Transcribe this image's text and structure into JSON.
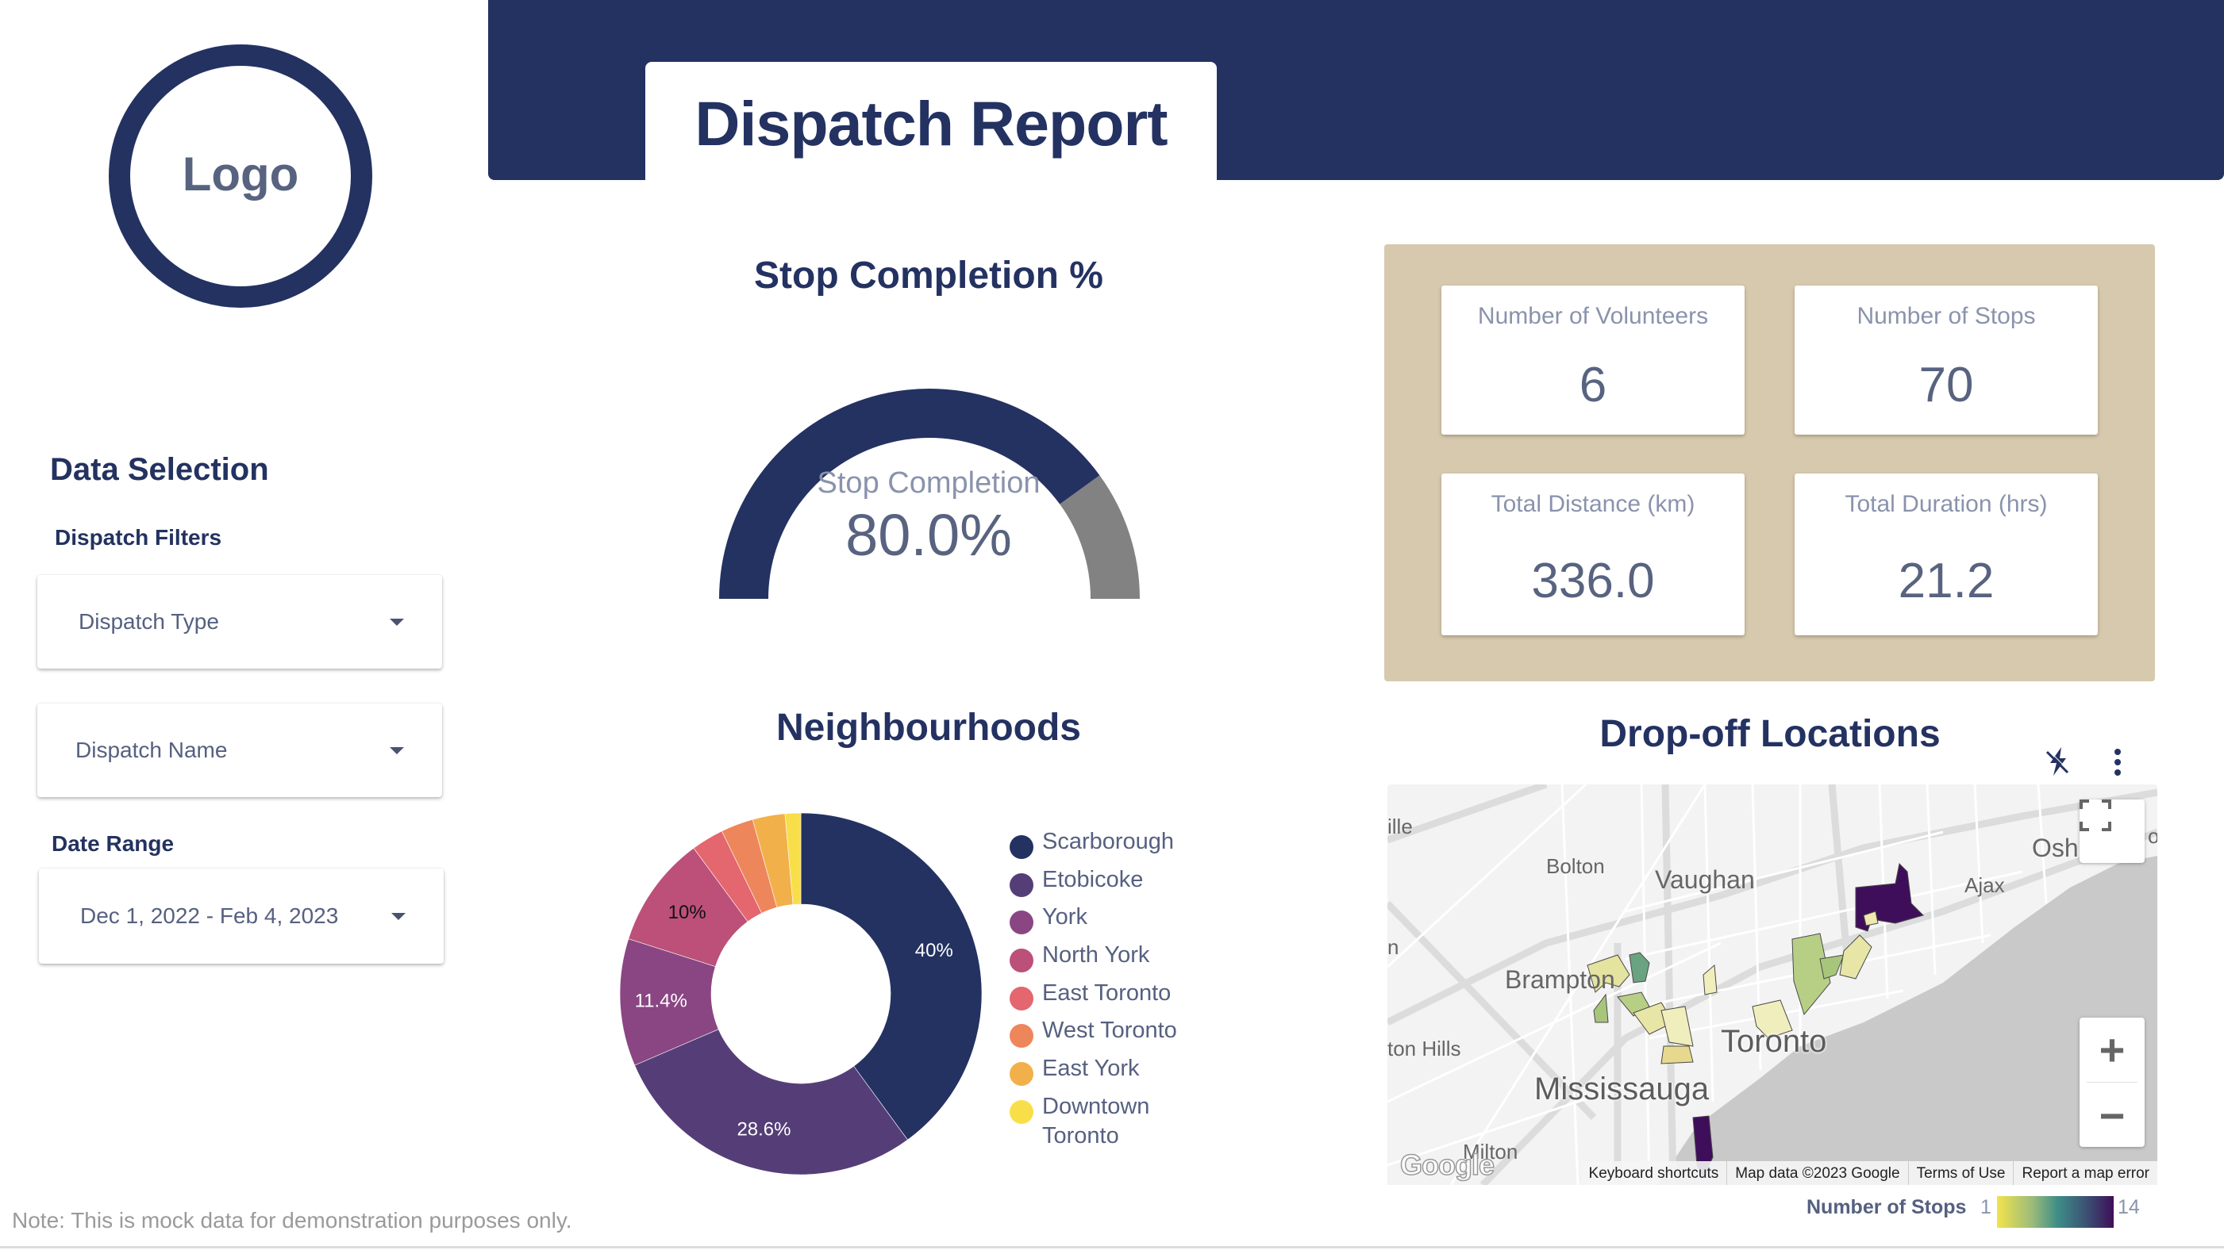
{
  "logo": {
    "label": "Logo"
  },
  "header": {
    "title": "Dispatch Report"
  },
  "data_selection": {
    "title": "Data Selection",
    "filters_title": "Dispatch Filters",
    "dispatch_type": {
      "label": "Dispatch Type",
      "icon": "arrow-drop-down-icon"
    },
    "dispatch_name": {
      "label": "Dispatch Name",
      "icon": "arrow-drop-down-icon"
    },
    "date_range_title": "Date Range",
    "date_range": {
      "value": "Dec 1, 2022 - Feb 4, 2023",
      "icon": "arrow-drop-down-icon"
    }
  },
  "note": "Note: This is mock data for demonstration purposes only.",
  "gauge": {
    "title": "Stop Completion %",
    "label": "Stop Completion",
    "value_text": "80.0%",
    "value_fraction": 0.8,
    "colors": {
      "filled": "#243262",
      "remaining": "#828282"
    }
  },
  "kpis": [
    {
      "label": "Number of Volunteers",
      "value": "6"
    },
    {
      "label": "Number of Stops",
      "value": "70"
    },
    {
      "label": "Total Distance (km)",
      "value": "336.0"
    },
    {
      "label": "Total Duration (hrs)",
      "value": "21.2"
    }
  ],
  "kpi_panel_color": "#d6c9ad",
  "chart_data": {
    "type": "pie",
    "title": "Neighbourhoods",
    "donut": true,
    "categories": [
      "Scarborough",
      "Etobicoke",
      "York",
      "North York",
      "East Toronto",
      "West Toronto",
      "East York",
      "Downtown Toronto"
    ],
    "values": [
      40,
      28.6,
      11.4,
      10,
      2.9,
      2.9,
      2.9,
      1.4
    ],
    "data_labels": [
      "40%",
      "28.6%",
      "11.4%",
      "10%",
      "",
      "",
      "",
      ""
    ],
    "colors": [
      "#243262",
      "#553e78",
      "#8a4682",
      "#bc5079",
      "#e4666e",
      "#ee865b",
      "#f2b04b",
      "#f8df4a"
    ],
    "label_colors": [
      "#ffffff",
      "#ffffff",
      "#ffffff",
      "#111111",
      "",
      "",
      "",
      ""
    ],
    "legend_position": "right"
  },
  "map": {
    "title": "Drop-off Locations",
    "header_icons": [
      "cross-filter-off-icon",
      "more-vert-icon"
    ],
    "place_labels": [
      {
        "text": "ille",
        "size": "small"
      },
      {
        "text": "Bolton",
        "size": "small"
      },
      {
        "text": "Vaughan",
        "size": "mid"
      },
      {
        "text": "Osha",
        "size": "mid"
      },
      {
        "text": "ow",
        "size": "small"
      },
      {
        "text": "Ajax",
        "size": "small"
      },
      {
        "text": "n",
        "size": "small"
      },
      {
        "text": "Brampton",
        "size": "mid"
      },
      {
        "text": "ton Hills",
        "size": "small"
      },
      {
        "text": "Toronto",
        "size": "big"
      },
      {
        "text": "Mississauga",
        "size": "big"
      },
      {
        "text": "Milton",
        "size": "small"
      }
    ],
    "google_logo": "Google",
    "footer": [
      "Keyboard shortcuts",
      "Map data ©2023 Google",
      "Terms of Use",
      "Report a map error"
    ],
    "controls": {
      "fullscreen": "fullscreen-icon",
      "zoom_in": "+",
      "zoom_out": "−"
    },
    "color_legend": {
      "title": "Number of Stops",
      "min": "1",
      "max": "14"
    }
  }
}
